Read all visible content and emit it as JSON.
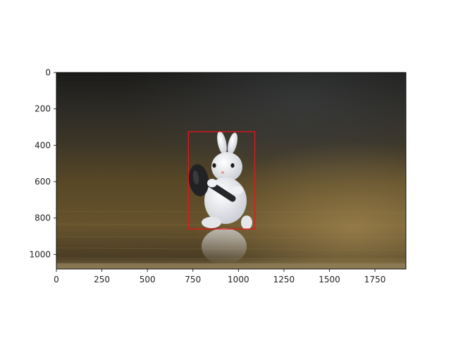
{
  "figure": {
    "image": {
      "description_icon": "photo-rabbit-figurine-with-hammer",
      "scene_colors": {
        "background_dark": "#1d1d1b",
        "wood_mid": "#5a4726",
        "wood_light": "#8a6f3e",
        "highlight": "#c9b98c",
        "rabbit_white": "#eef0f4",
        "hammer_black": "#222224"
      }
    },
    "xlim": [
      0,
      1920
    ],
    "ylim": [
      1080,
      0
    ],
    "x_ticks": [
      0,
      250,
      500,
      750,
      1000,
      1250,
      1500,
      1750
    ],
    "y_ticks": [
      0,
      200,
      400,
      600,
      800,
      1000
    ],
    "bounding_box": {
      "x_min": 725,
      "y_min": 325,
      "x_max": 1090,
      "y_max": 860,
      "color": "#e8141c"
    }
  }
}
